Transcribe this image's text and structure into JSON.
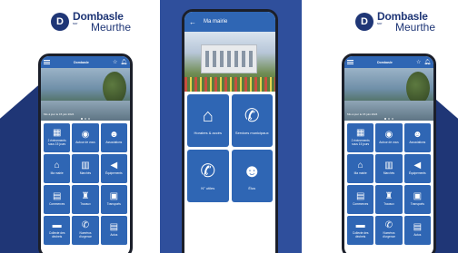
{
  "brand": {
    "name_line1": "Dombasle",
    "name_line2": "Meurthe",
    "name_small": "sur",
    "emblem": "D"
  },
  "phone_home": {
    "app_bar": {
      "logo_text": "Dombasle",
      "menu_icon": "hamburger-icon",
      "icons": [
        "star-icon",
        "bell-icon"
      ]
    },
    "hero_caption": "Mis à jour le 15 juin 2024",
    "tiles": [
      {
        "label": "2 événements sous 15 jours",
        "icon": "calendar-icon"
      },
      {
        "label": "Autour de vous",
        "icon": "location-pin-icon"
      },
      {
        "label": "Associations",
        "icon": "people-icon"
      },
      {
        "label": "Ma mairie",
        "icon": "town-hall-icon"
      },
      {
        "label": "Marchés",
        "icon": "market-icon"
      },
      {
        "label": "Équipements",
        "icon": "megaphone-icon"
      },
      {
        "label": "Commerces",
        "icon": "basket-icon"
      },
      {
        "label": "Travaux",
        "icon": "worker-icon"
      },
      {
        "label": "Transports",
        "icon": "train-icon"
      },
      {
        "label": "Collecte des déchets",
        "icon": "truck-icon"
      },
      {
        "label": "Numéros d'urgence",
        "icon": "phone-icon"
      },
      {
        "label": "Actus",
        "icon": "news-icon"
      }
    ]
  },
  "phone_mairie": {
    "title": "Ma mairie",
    "back_icon": "arrow-left-icon",
    "tiles": [
      {
        "label": "Horaires & accès",
        "icon": "town-hall-icon"
      },
      {
        "label": "Services municipaux",
        "icon": "phone-info-icon"
      },
      {
        "label": "N° utiles",
        "icon": "phone-icon"
      },
      {
        "label": "Élus",
        "icon": "person-icon"
      }
    ]
  },
  "colors": {
    "brand_navy": "#1f3676",
    "tile_blue": "#2f66b4",
    "panel_blue": "#2f4f9c"
  }
}
